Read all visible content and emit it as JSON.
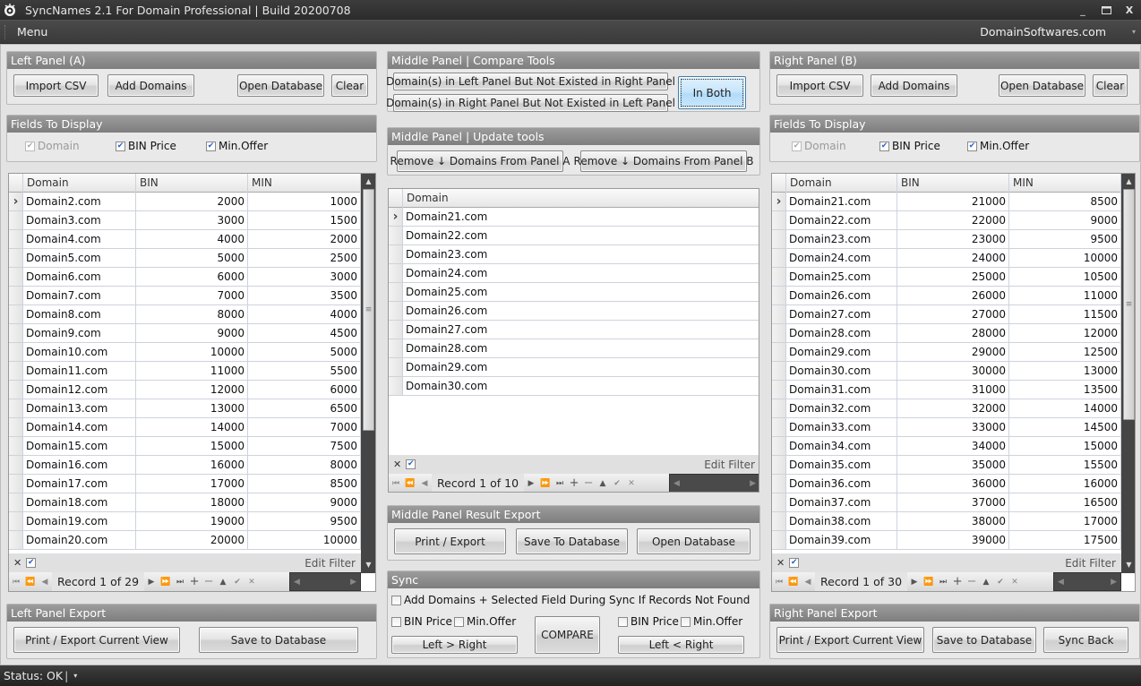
{
  "titlebar": {
    "title": "SyncNames 2.1 For Domain Professional  |  Build 20200708",
    "icon": "app-logo-icon",
    "controls": {
      "minimize": "_",
      "maximize": "▭",
      "close": "X"
    }
  },
  "menubar": {
    "menu_label": "Menu",
    "site_link": "DomainSoftwares.com",
    "dropdown_icon": "▾"
  },
  "left": {
    "panel_title": "Left Panel (A)",
    "buttons": {
      "import_csv": "Import CSV",
      "add_domains": "Add Domains",
      "open_database": "Open Database",
      "clear": "Clear"
    },
    "fields_title": "Fields To Display",
    "fields": [
      {
        "label": "Domain",
        "checked": true,
        "disabled": true
      },
      {
        "label": "BIN Price",
        "checked": true,
        "disabled": false
      },
      {
        "label": "Min.Offer",
        "checked": true,
        "disabled": false
      }
    ],
    "grid": {
      "columns": [
        "Domain",
        "BIN",
        "MIN"
      ],
      "rows": [
        [
          "Domain2.com",
          "2000",
          "1000"
        ],
        [
          "Domain3.com",
          "3000",
          "1500"
        ],
        [
          "Domain4.com",
          "4000",
          "2000"
        ],
        [
          "Domain5.com",
          "5000",
          "2500"
        ],
        [
          "Domain6.com",
          "6000",
          "3000"
        ],
        [
          "Domain7.com",
          "7000",
          "3500"
        ],
        [
          "Domain8.com",
          "8000",
          "4000"
        ],
        [
          "Domain9.com",
          "9000",
          "4500"
        ],
        [
          "Domain10.com",
          "10000",
          "5000"
        ],
        [
          "Domain11.com",
          "11000",
          "5500"
        ],
        [
          "Domain12.com",
          "12000",
          "6000"
        ],
        [
          "Domain13.com",
          "13000",
          "6500"
        ],
        [
          "Domain14.com",
          "14000",
          "7000"
        ],
        [
          "Domain15.com",
          "15000",
          "7500"
        ],
        [
          "Domain16.com",
          "16000",
          "8000"
        ],
        [
          "Domain17.com",
          "17000",
          "8500"
        ],
        [
          "Domain18.com",
          "18000",
          "9000"
        ],
        [
          "Domain19.com",
          "19000",
          "9500"
        ],
        [
          "Domain20.com",
          "20000",
          "10000"
        ]
      ],
      "current_row": 0,
      "edit_filter": "Edit Filter",
      "record_text": "Record 1 of 29"
    },
    "export_title": "Left Panel Export",
    "export_buttons": {
      "print": "Print / Export Current View",
      "save": "Save to Database"
    }
  },
  "middle": {
    "compare_title": "Middle Panel | Compare Tools",
    "compare_buttons": {
      "left_not_right": "Domain(s) in Left Panel But Not Existed in Right Panel",
      "right_not_left": "Domain(s) in Right Panel But Not Existed in Left Panel",
      "in_both": "In Both"
    },
    "update_title": "Middle Panel | Update tools",
    "update_buttons": {
      "remove_a": "Remove ↓ Domains From Panel A",
      "remove_b": "Remove ↓ Domains From Panel B"
    },
    "grid": {
      "columns": [
        "Domain"
      ],
      "rows": [
        [
          "Domain21.com"
        ],
        [
          "Domain22.com"
        ],
        [
          "Domain23.com"
        ],
        [
          "Domain24.com"
        ],
        [
          "Domain25.com"
        ],
        [
          "Domain26.com"
        ],
        [
          "Domain27.com"
        ],
        [
          "Domain28.com"
        ],
        [
          "Domain29.com"
        ],
        [
          "Domain30.com"
        ]
      ],
      "current_row": 0,
      "edit_filter": "Edit Filter",
      "record_text": "Record 1 of 10"
    },
    "export_title": "Middle Panel Result Export",
    "export_buttons": {
      "print": "Print / Export",
      "save": "Save To Database",
      "open": "Open Database"
    },
    "sync": {
      "title": "Sync",
      "add_if_not_found": {
        "label": "Add Domains + Selected Field During Sync If Records Not Found",
        "checked": false
      },
      "left_fields": [
        {
          "label": "BIN Price",
          "checked": false
        },
        {
          "label": "Min.Offer",
          "checked": false
        }
      ],
      "right_fields": [
        {
          "label": "BIN Price",
          "checked": false
        },
        {
          "label": "Min.Offer",
          "checked": false
        }
      ],
      "left_to_right": "Left > Right",
      "compare": "COMPARE",
      "right_to_left": "Left < Right"
    }
  },
  "right": {
    "panel_title": "Right Panel (B)",
    "buttons": {
      "import_csv": "Import CSV",
      "add_domains": "Add Domains",
      "open_database": "Open Database",
      "clear": "Clear"
    },
    "fields_title": "Fields To Display",
    "fields": [
      {
        "label": "Domain",
        "checked": true,
        "disabled": true
      },
      {
        "label": "BIN Price",
        "checked": true,
        "disabled": false
      },
      {
        "label": "Min.Offer",
        "checked": true,
        "disabled": false
      }
    ],
    "grid": {
      "columns": [
        "Domain",
        "BIN",
        "MIN"
      ],
      "rows": [
        [
          "Domain21.com",
          "21000",
          "8500"
        ],
        [
          "Domain22.com",
          "22000",
          "9000"
        ],
        [
          "Domain23.com",
          "23000",
          "9500"
        ],
        [
          "Domain24.com",
          "24000",
          "10000"
        ],
        [
          "Domain25.com",
          "25000",
          "10500"
        ],
        [
          "Domain26.com",
          "26000",
          "11000"
        ],
        [
          "Domain27.com",
          "27000",
          "11500"
        ],
        [
          "Domain28.com",
          "28000",
          "12000"
        ],
        [
          "Domain29.com",
          "29000",
          "12500"
        ],
        [
          "Domain30.com",
          "30000",
          "13000"
        ],
        [
          "Domain31.com",
          "31000",
          "13500"
        ],
        [
          "Domain32.com",
          "32000",
          "14000"
        ],
        [
          "Domain33.com",
          "33000",
          "14500"
        ],
        [
          "Domain34.com",
          "34000",
          "15000"
        ],
        [
          "Domain35.com",
          "35000",
          "15500"
        ],
        [
          "Domain36.com",
          "36000",
          "16000"
        ],
        [
          "Domain37.com",
          "37000",
          "16500"
        ],
        [
          "Domain38.com",
          "38000",
          "17000"
        ],
        [
          "Domain39.com",
          "39000",
          "17500"
        ]
      ],
      "current_row": 0,
      "edit_filter": "Edit Filter",
      "record_text": "Record 1 of 30"
    },
    "export_title": "Right Panel Export",
    "export_buttons": {
      "print": "Print / Export Current View",
      "save": "Save to Database",
      "sync_back": "Sync Back"
    }
  },
  "statusbar": {
    "status": "Status: OK",
    "separator": "|",
    "dropdown_icon": "▾"
  }
}
